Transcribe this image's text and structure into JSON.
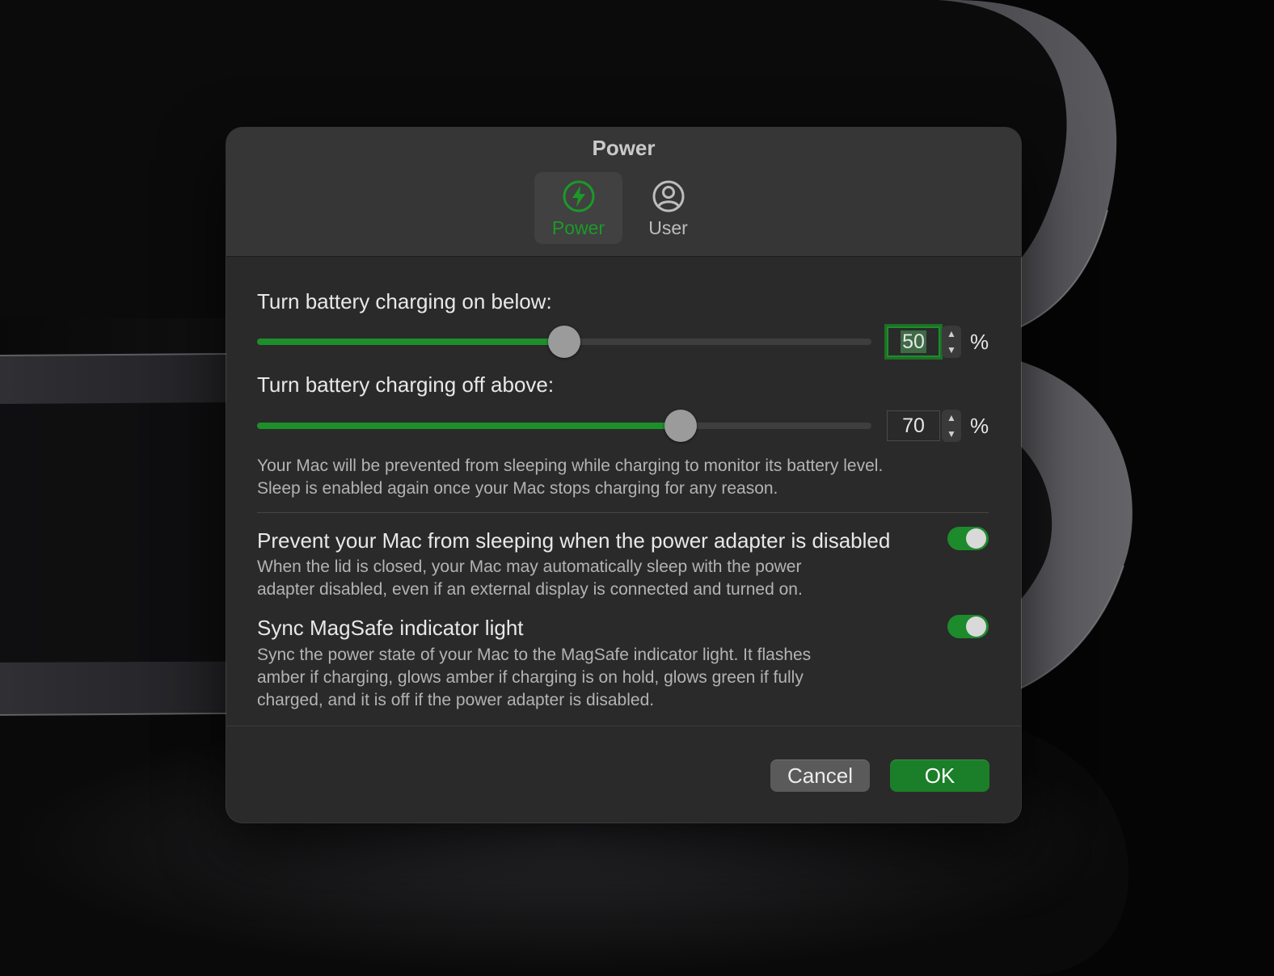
{
  "window": {
    "title": "Power",
    "tabs": [
      {
        "label": "Power",
        "icon": "lightning-bolt-icon",
        "active": true
      },
      {
        "label": "User",
        "icon": "user-circle-icon",
        "active": false
      }
    ]
  },
  "charging": {
    "on_below_label": "Turn battery charging on below:",
    "on_below_value": "50",
    "off_above_label": "Turn battery charging off above:",
    "off_above_value": "70",
    "unit": "%",
    "note_line1": "Your Mac will be prevented from sleeping while charging to monitor its battery level.",
    "note_line2": "Sleep is enabled again once your Mac stops charging for any reason."
  },
  "options": {
    "prevent_sleep": {
      "title": "Prevent your Mac from sleeping when the power adapter is disabled",
      "desc_line1": "When the lid is closed, your Mac may automatically sleep with the power",
      "desc_line2": "adapter disabled, even if an external display is connected and turned on.",
      "enabled": true
    },
    "magsafe": {
      "title": "Sync MagSafe indicator light",
      "desc_line1": "Sync the power state of your Mac to the MagSafe indicator light. It flashes",
      "desc_line2": "amber if charging, glows amber if charging is on hold, glows green if fully",
      "desc_line3": "charged, and it is off if the power adapter is disabled.",
      "enabled": true
    }
  },
  "buttons": {
    "cancel": "Cancel",
    "ok": "OK"
  },
  "colors": {
    "accent": "#1d8a2c",
    "window_bg": "#2a2a2a",
    "titlebar_bg": "#363636"
  }
}
